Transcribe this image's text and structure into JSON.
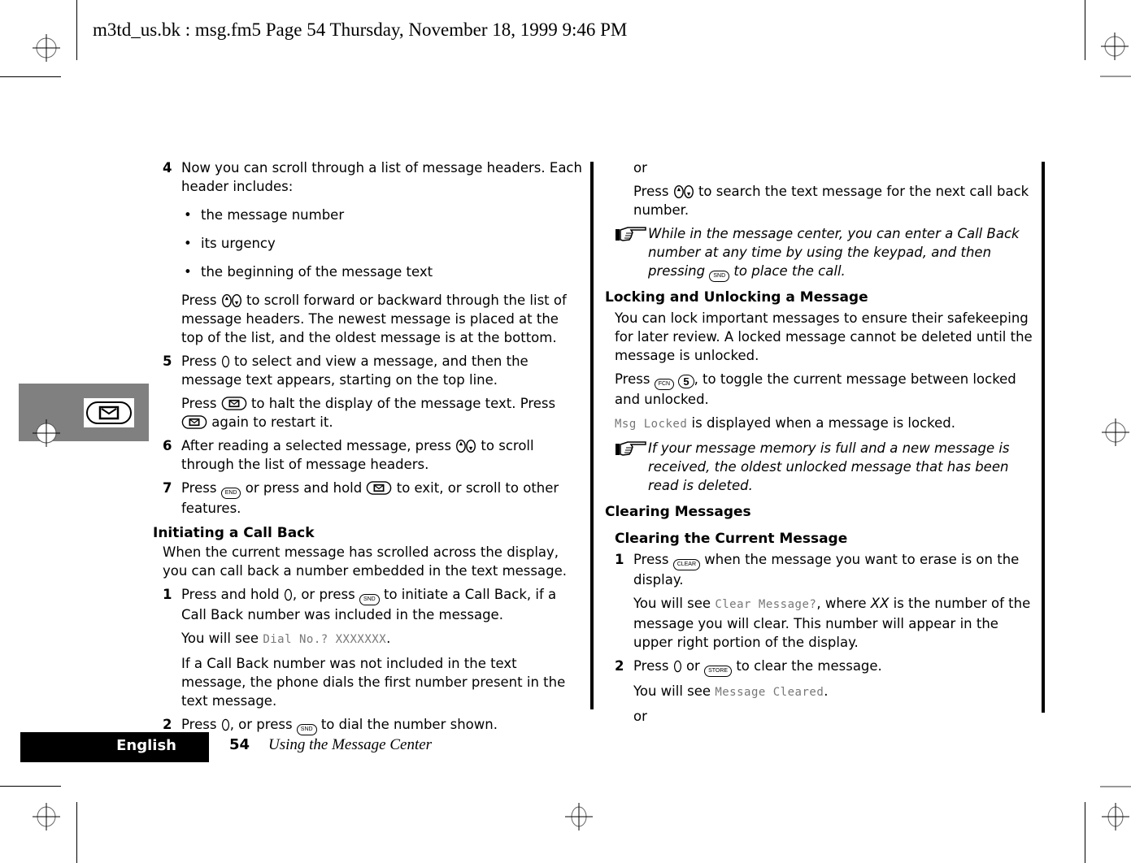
{
  "slug": "m3td_us.bk : msg.fm5  Page 54  Thursday, November 18, 1999  9:46 PM",
  "side_tab": {
    "icon": "message-key-icon"
  },
  "footer": {
    "language": "English",
    "page_number": "54",
    "section_title": "Using the Message Center"
  },
  "left_column": {
    "step4": {
      "num": "4",
      "text": "Now you can scroll through a list of message headers. Each header includes:"
    },
    "bullets": [
      "the message number",
      "its urgency",
      "the beginning of the message text"
    ],
    "step4_sub": {
      "pre": "Press",
      "post": "to scroll forward or backward through the list of message headers. The newest message is placed at the top of the list, and the oldest message is at the bottom."
    },
    "step5": {
      "num": "5",
      "pre": "Press",
      "post": "to select and view a message, and then the message text appears, starting on the top line."
    },
    "step5_sub": {
      "pre": "Press",
      "mid": "to halt the display of the message text. Press",
      "post": "again to restart it."
    },
    "step6": {
      "num": "6",
      "pre": "After reading a selected message, press",
      "post": "to scroll through the list of message headers."
    },
    "step7": {
      "num": "7",
      "pre": "Press",
      "mid": "or press and hold",
      "post": "to exit, or scroll to other features."
    },
    "heading_callback": "Initiating a Call Back",
    "callback_intro": "When the current message has scrolled across the display, you can call back a number embedded in the text message.",
    "cb_step1": {
      "num": "1",
      "pre": "Press and hold",
      "mid": ", or press",
      "post": "to initiate a Call Back, if a Call Back number was included in the message."
    },
    "cb_step1_see": {
      "pre": "You will see",
      "lcd": "Dial No.? XXXXXXX",
      "post": "."
    },
    "cb_step1_note": "If a Call Back number was not included in the text message, the phone dials the first number present in the text message.",
    "cb_step2": {
      "num": "2",
      "pre": "Press",
      "mid": ", or press",
      "post": "to dial the number shown."
    }
  },
  "right_column": {
    "or1": "or",
    "search": {
      "pre": "Press",
      "post": "to search the text message for the next call back number."
    },
    "note1": {
      "pre": "While in the message center, you can enter a Call Back number at any time by using the keypad, and then pressing",
      "post": "to place the call."
    },
    "heading_lock": "Locking and Unlocking a Message",
    "lock_intro": "You can lock important messages to ensure their safekeeping for later review. A locked message cannot be deleted until the message is unlocked.",
    "lock_press": {
      "pre": "Press",
      "post": ", to toggle the current message between locked and unlocked."
    },
    "lock_display": {
      "lcd": "Msg Locked",
      "post": "is displayed when a message is locked."
    },
    "note2": "If your message memory is full and a new message is received, the oldest unlocked message that has been read is deleted.",
    "heading_clear": "Clearing Messages",
    "subheading_clear_current": "Clearing the Current Message",
    "clr_step1": {
      "num": "1",
      "pre": "Press",
      "post": "when the message you want to erase is on the display."
    },
    "clr_step1_see": {
      "pre": "You will see",
      "lcd": "Clear Message?",
      "mid": ", where",
      "xx": "XX",
      "post": "is the number of the message you will clear. This number will appear in the upper right portion of the display."
    },
    "clr_step2": {
      "num": "2",
      "pre": "Press",
      "mid": "or",
      "post": "to clear the message."
    },
    "clr_step2_see": {
      "pre": "You will see",
      "lcd": "Message Cleared",
      "post": "."
    },
    "or2": "or"
  },
  "keys": {
    "snd": "SND",
    "end": "END",
    "fcn": "FCN",
    "five": "5",
    "clear": "CLEAR",
    "store": "STORE"
  }
}
